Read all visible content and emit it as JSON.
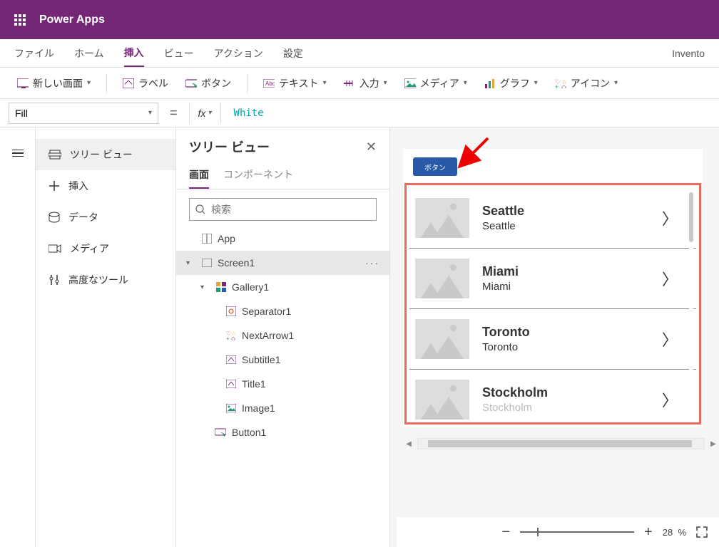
{
  "titlebar": {
    "app_name": "Power Apps"
  },
  "menubar": {
    "items": [
      "ファイル",
      "ホーム",
      "挿入",
      "ビュー",
      "アクション",
      "設定"
    ],
    "active_index": 2,
    "file_name": "Invento"
  },
  "ribbon": {
    "new_screen": "新しい画面",
    "label": "ラベル",
    "button": "ボタン",
    "text": "テキスト",
    "input": "入力",
    "media": "メディア",
    "chart": "グラフ",
    "icon": "アイコン"
  },
  "formula": {
    "property": "Fill",
    "fx": "fx",
    "value": "White"
  },
  "side_panel": {
    "items": [
      "ツリー ビュー",
      "挿入",
      "データ",
      "メディア",
      "高度なツール"
    ],
    "active_index": 0
  },
  "tree": {
    "title": "ツリー ビュー",
    "tabs": [
      "画面",
      "コンポーネント"
    ],
    "active_tab": 0,
    "search_placeholder": "検索",
    "nodes": {
      "app": "App",
      "screen1": "Screen1",
      "gallery1": "Gallery1",
      "separator1": "Separator1",
      "nextarrow1": "NextArrow1",
      "subtitle1": "Subtitle1",
      "title1": "Title1",
      "image1": "Image1",
      "button1": "Button1"
    }
  },
  "canvas": {
    "button_label": "ボタン",
    "gallery_items": [
      {
        "title": "Seattle",
        "subtitle": "Seattle"
      },
      {
        "title": "Miami",
        "subtitle": "Miami"
      },
      {
        "title": "Toronto",
        "subtitle": "Toronto"
      },
      {
        "title": "Stockholm",
        "subtitle": "Stockholm"
      }
    ]
  },
  "statusbar": {
    "zoom": "28",
    "zoom_unit": "%"
  }
}
